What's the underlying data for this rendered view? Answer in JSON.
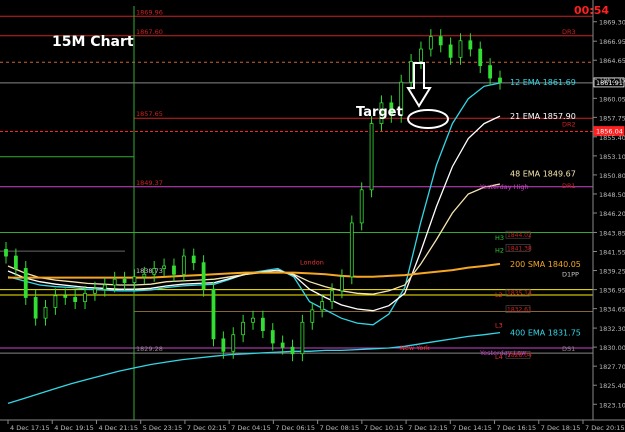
{
  "chart_data": {
    "type": "line",
    "title": "15M Chart",
    "annotation_target": "Target",
    "countdown": "00:54",
    "yaxis_ticks": [
      1869.3,
      1866.95,
      1864.65,
      1862.35,
      1860.05,
      1857.75,
      1855.4,
      1853.1,
      1850.8,
      1848.5,
      1846.2,
      1843.85,
      1841.55,
      1839.25,
      1836.95,
      1834.65,
      1832.3,
      1830.0,
      1827.7,
      1825.4,
      1823.1
    ],
    "ylim": [
      1821.2,
      1871.2
    ],
    "xaxis_ticks": [
      "4 Dec 17:15",
      "4 Dec 19:15",
      "4 Dec 21:15",
      "5 Dec 23:15",
      "7 Dec 02:15",
      "7 Dec 04:15",
      "7 Dec 06:15",
      "7 Dec 08:15",
      "7 Dec 10:15",
      "7 Dec 12:15",
      "7 Dec 14:15",
      "7 Dec 16:15",
      "7 Dec 18:15",
      "7 Dec 20:15"
    ],
    "price_tags": [
      {
        "value": 1861.91,
        "label": "1861.91",
        "color": "#ffffff"
      },
      {
        "value": 1856.04,
        "label": "1856.04",
        "color": "#ff2020"
      }
    ],
    "level_labels_left": [
      {
        "value": 1869.96,
        "label": "1869.96",
        "color": "#cc2222"
      },
      {
        "value": 1867.6,
        "label": "1867.60",
        "color": "#cc2222"
      },
      {
        "value": 1857.65,
        "label": "1857.65",
        "color": "#cc2222"
      },
      {
        "value": 1849.37,
        "label": "1849.37",
        "color": "#cc2222"
      },
      {
        "value": 1838.73,
        "label": "1838.73",
        "color": "#cccccc"
      },
      {
        "value": 1829.28,
        "label": "1829.28",
        "color": "#888888"
      }
    ],
    "level_labels_right": [
      {
        "value": 1867.6,
        "label": "DR3",
        "color": "#cc2222"
      },
      {
        "value": 1856.4,
        "label": "DR2",
        "color": "#cc2222"
      },
      {
        "value": 1849.0,
        "label": "DR1",
        "color": "#cc2222"
      },
      {
        "value": 1838.3,
        "label": "D1PP",
        "color": "#cccccc"
      },
      {
        "value": 1829.28,
        "label": "DS1",
        "color": "#888888"
      }
    ],
    "ema_labels": [
      {
        "label": "12 EMA 1861.69",
        "value": 1862.0,
        "color": "#33d6e6"
      },
      {
        "label": "21 EMA 1857.90",
        "value": 1857.9,
        "color": "#ffffff"
      },
      {
        "label": "48 EMA 1849.67",
        "value": 1851.0,
        "color": "#f5e6b0"
      },
      {
        "label": "200 SMA 1840.05",
        "value": 1840.05,
        "color": "#f5a623"
      },
      {
        "label": "400 EMA 1831.75",
        "value": 1831.75,
        "color": "#33d6e6"
      }
    ],
    "camarilla_labels": [
      {
        "label": "Yesterday High",
        "value": 1849.37,
        "color": "#cc44cc"
      },
      {
        "label": "H3",
        "value": 1843.2,
        "color": "#33cc33"
      },
      {
        "label": "H2",
        "value": 1841.7,
        "color": "#33cc33"
      },
      {
        "label": "L2",
        "value": 1836.3,
        "color": "#ee3333"
      },
      {
        "label": "L3",
        "value": 1832.6,
        "color": "#ee3333"
      },
      {
        "label": "L4",
        "value": 1828.8,
        "color": "#ee3333"
      },
      {
        "label": "Yesterday Low",
        "value": 1829.3,
        "color": "#cc44cc"
      },
      {
        "label": "London",
        "value": 1840.2,
        "color": "#ee3333"
      },
      {
        "label": "New York",
        "value": 1829.9,
        "color": "#ee3333"
      }
    ],
    "camarilla_value_tags": [
      {
        "label": "1844.02",
        "value": 1843.4
      },
      {
        "label": "1841.38",
        "value": 1841.8
      },
      {
        "label": "1835.14",
        "value": 1836.4
      },
      {
        "label": "1832.61",
        "value": 1834.4
      },
      {
        "label": "1828.04",
        "value": 1828.9
      }
    ],
    "series": [
      {
        "name": "12 EMA",
        "color": "#33d6e6",
        "values": [
          1838.5,
          1838.0,
          1837.5,
          1837.3,
          1837.2,
          1837.0,
          1836.9,
          1836.8,
          1836.8,
          1836.9,
          1837.2,
          1837.4,
          1837.5,
          1837.6,
          1838.2,
          1838.9,
          1839.2,
          1839.5,
          1838.5,
          1835.5,
          1834.5,
          1833.5,
          1832.9,
          1832.7,
          1834.0,
          1837.2,
          1845.0,
          1852.0,
          1857.0,
          1860.0,
          1861.5,
          1861.9
        ]
      },
      {
        "name": "21 EMA",
        "color": "#ffffff",
        "values": [
          1839.2,
          1838.4,
          1837.9,
          1837.6,
          1837.4,
          1837.2,
          1837.1,
          1837.0,
          1837.0,
          1837.1,
          1837.4,
          1837.6,
          1837.7,
          1837.8,
          1838.3,
          1838.8,
          1839.1,
          1839.3,
          1838.7,
          1837.0,
          1836.0,
          1835.1,
          1834.6,
          1834.4,
          1835.0,
          1836.5,
          1841.5,
          1847.0,
          1851.8,
          1855.2,
          1857.0,
          1857.9
        ]
      },
      {
        "name": "48 EMA",
        "color": "#f5e6b0",
        "values": [
          1839.8,
          1839.0,
          1838.4,
          1838.1,
          1837.9,
          1837.7,
          1837.6,
          1837.5,
          1837.5,
          1837.6,
          1837.9,
          1838.0,
          1838.1,
          1838.2,
          1838.5,
          1838.8,
          1839.0,
          1839.1,
          1838.8,
          1837.9,
          1837.3,
          1836.8,
          1836.5,
          1836.4,
          1836.8,
          1837.5,
          1840.0,
          1843.0,
          1846.2,
          1848.5,
          1849.3,
          1849.7
        ]
      },
      {
        "name": "200 SMA",
        "color": "#f5a623",
        "values": [
          1838.4,
          1838.4,
          1838.4,
          1838.4,
          1838.4,
          1838.4,
          1838.4,
          1838.4,
          1838.4,
          1838.4,
          1838.5,
          1838.6,
          1838.7,
          1838.8,
          1838.9,
          1839.0,
          1839.0,
          1839.0,
          1839.0,
          1838.9,
          1838.8,
          1838.6,
          1838.5,
          1838.5,
          1838.6,
          1838.7,
          1838.9,
          1839.1,
          1839.3,
          1839.6,
          1839.8,
          1840.05
        ]
      },
      {
        "name": "400 EMA",
        "color": "#33d6e6",
        "values": [
          1823.2,
          1823.8,
          1824.4,
          1825.0,
          1825.6,
          1826.1,
          1826.6,
          1827.1,
          1827.5,
          1827.9,
          1828.2,
          1828.5,
          1828.7,
          1828.9,
          1829.1,
          1829.2,
          1829.3,
          1829.4,
          1829.5,
          1829.5,
          1829.6,
          1829.6,
          1829.7,
          1829.8,
          1829.9,
          1830.1,
          1830.4,
          1830.7,
          1831.0,
          1831.3,
          1831.5,
          1831.75
        ]
      }
    ],
    "candles_close": [
      1841.0,
      1839.5,
      1836.0,
      1833.5,
      1834.8,
      1836.2,
      1836.0,
      1835.5,
      1836.5,
      1837.0,
      1837.5,
      1838.2,
      1837.8,
      1838.5,
      1838.8,
      1839.5,
      1839.8,
      1838.8,
      1841.0,
      1840.2,
      1837.0,
      1831.0,
      1829.5,
      1831.5,
      1833.0,
      1833.5,
      1832.0,
      1830.5,
      1830.0,
      1829.2,
      1833.0,
      1834.5,
      1835.5,
      1836.8,
      1838.5,
      1845.0,
      1849.0,
      1857.0,
      1859.5,
      1858.0,
      1862.0,
      1864.5,
      1866.0,
      1867.5,
      1866.5,
      1865.0,
      1867.0,
      1866.0,
      1864.0,
      1862.5,
      1862.0
    ]
  }
}
